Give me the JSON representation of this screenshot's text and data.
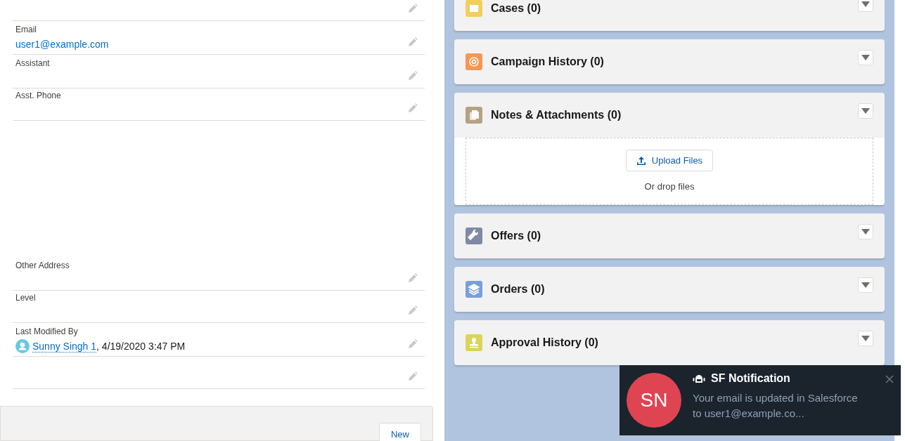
{
  "fields": [
    {
      "kind": "text"
    },
    {
      "kind": "email",
      "label": "Email",
      "value": "user1@example.com"
    },
    {
      "kind": "text",
      "label": "Assistant"
    },
    {
      "kind": "text",
      "label": "Asst. Phone"
    },
    {
      "kind": "spacer"
    },
    {
      "kind": "text",
      "label": "Other Address"
    },
    {
      "kind": "text",
      "label": "Level"
    },
    {
      "kind": "user",
      "label": "Last Modified By",
      "user": "Sunny Singh 1",
      "value": ", 4/19/2020 3:47 PM"
    },
    {
      "kind": "text"
    }
  ],
  "footer": {
    "button": "New"
  },
  "related": [
    {
      "color": "#f2cf5b",
      "title": "Cases (0)"
    },
    {
      "color": "#f49756",
      "title": "Campaign History (0)"
    },
    {
      "color": "#b5a283",
      "title": "Notes & Attachments (0)",
      "upload": {
        "button": "Upload Files",
        "hint": "Or drop files"
      }
    },
    {
      "color": "#7e8aa5",
      "title": "Offers (0)"
    },
    {
      "color": "#779fdb",
      "title": "Orders (0)"
    },
    {
      "color": "#d9d55a",
      "title": "Approval History (0)"
    }
  ],
  "toast": {
    "avatar": "SN",
    "title": "SF Notification",
    "message": "Your email is updated in Salesforce to user1@example.co..."
  }
}
